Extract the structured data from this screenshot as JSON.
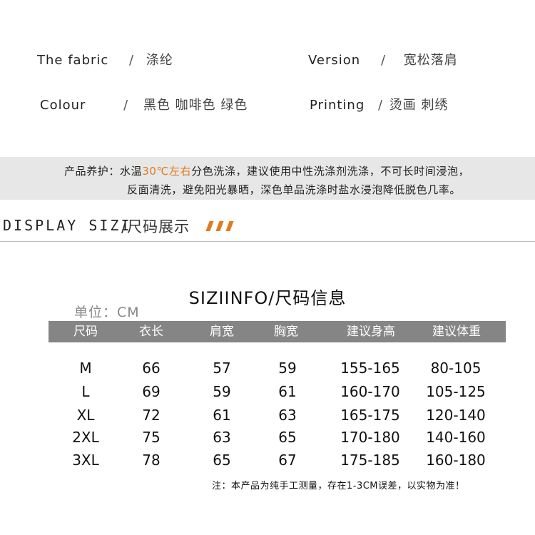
{
  "product_info": {
    "fabric": {
      "label": "The fabric",
      "sep": "/",
      "value": "涤纶"
    },
    "version": {
      "label": "Version",
      "sep": "/",
      "value": "宽松落肩"
    },
    "colour": {
      "label": "Colour",
      "sep": "/",
      "value": "黑色 咖啡色 绿色"
    },
    "printing": {
      "label": "Printing",
      "sep": "/",
      "value": "烫画 刺绣"
    }
  },
  "care": {
    "line1_prefix": "产品养护：水温",
    "line1_highlight": "30℃左右",
    "line1_suffix": "分色洗涤，建议使用中性洗涤剂洗涤，不可长时间浸泡，",
    "line2": "反面清洗，避免阳光暴晒，深色单品洗涤时盐水浸泡降低脱色几率。"
  },
  "display": {
    "title": "DISPLAY SIZI",
    "subtitle": "/尺码展示"
  },
  "size_table": {
    "title": "SIZIINFO/尺码信息",
    "unit": "单位：CM",
    "headers": [
      "尺码",
      "衣长",
      "肩宽",
      "胸宽",
      "建议身高",
      "建议体重"
    ],
    "rows": [
      [
        "M",
        "66",
        "57",
        "59",
        "155-165",
        "80-105"
      ],
      [
        "L",
        "69",
        "59",
        "61",
        "160-170",
        "105-125"
      ],
      [
        "XL",
        "72",
        "61",
        "63",
        "165-175",
        "120-140"
      ],
      [
        "2XL",
        "75",
        "63",
        "65",
        "170-180",
        "140-160"
      ],
      [
        "3XL",
        "78",
        "65",
        "67",
        "175-185",
        "160-180"
      ]
    ],
    "note": "注：本产品为纯手工测量，存在1-3CM误差，以实物为准！"
  },
  "colors": {
    "accent": "#e07b1f",
    "header_bg": "#858585",
    "care_bg": "#e7e7e7"
  }
}
